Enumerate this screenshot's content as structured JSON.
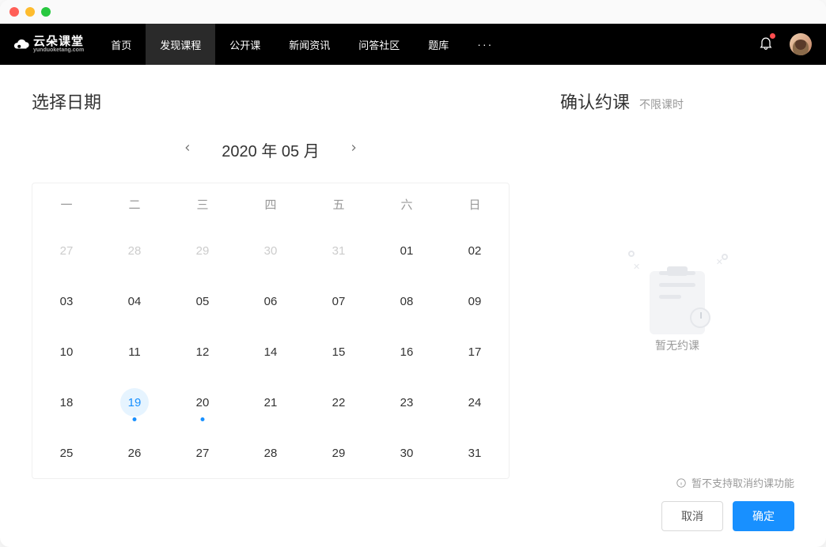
{
  "logo": {
    "cn": "云朵课堂",
    "en": "yunduoketang.com"
  },
  "nav": {
    "items": [
      {
        "label": "首页",
        "active": false
      },
      {
        "label": "发现课程",
        "active": true
      },
      {
        "label": "公开课",
        "active": false
      },
      {
        "label": "新闻资讯",
        "active": false
      },
      {
        "label": "问答社区",
        "active": false
      },
      {
        "label": "题库",
        "active": false
      }
    ]
  },
  "left": {
    "title": "选择日期",
    "month_label": "2020 年 05 月",
    "dow": [
      "一",
      "二",
      "三",
      "四",
      "五",
      "六",
      "日"
    ],
    "days": [
      {
        "n": "27",
        "other": true
      },
      {
        "n": "28",
        "other": true
      },
      {
        "n": "29",
        "other": true
      },
      {
        "n": "30",
        "other": true
      },
      {
        "n": "31",
        "other": true
      },
      {
        "n": "01"
      },
      {
        "n": "02"
      },
      {
        "n": "03"
      },
      {
        "n": "04"
      },
      {
        "n": "05"
      },
      {
        "n": "06"
      },
      {
        "n": "07"
      },
      {
        "n": "08"
      },
      {
        "n": "09"
      },
      {
        "n": "10"
      },
      {
        "n": "11"
      },
      {
        "n": "12"
      },
      {
        "n": "14"
      },
      {
        "n": "15"
      },
      {
        "n": "16"
      },
      {
        "n": "17"
      },
      {
        "n": "18"
      },
      {
        "n": "19",
        "today": true,
        "dot": true
      },
      {
        "n": "20",
        "dot": true
      },
      {
        "n": "21"
      },
      {
        "n": "22"
      },
      {
        "n": "23"
      },
      {
        "n": "24"
      },
      {
        "n": "25"
      },
      {
        "n": "26"
      },
      {
        "n": "27"
      },
      {
        "n": "28"
      },
      {
        "n": "29"
      },
      {
        "n": "30"
      },
      {
        "n": "31"
      }
    ]
  },
  "right": {
    "title": "确认约课",
    "subtitle": "不限课时",
    "empty_text": "暂无约课",
    "note": "暂不支持取消约课功能",
    "cancel": "取消",
    "confirm": "确定"
  }
}
